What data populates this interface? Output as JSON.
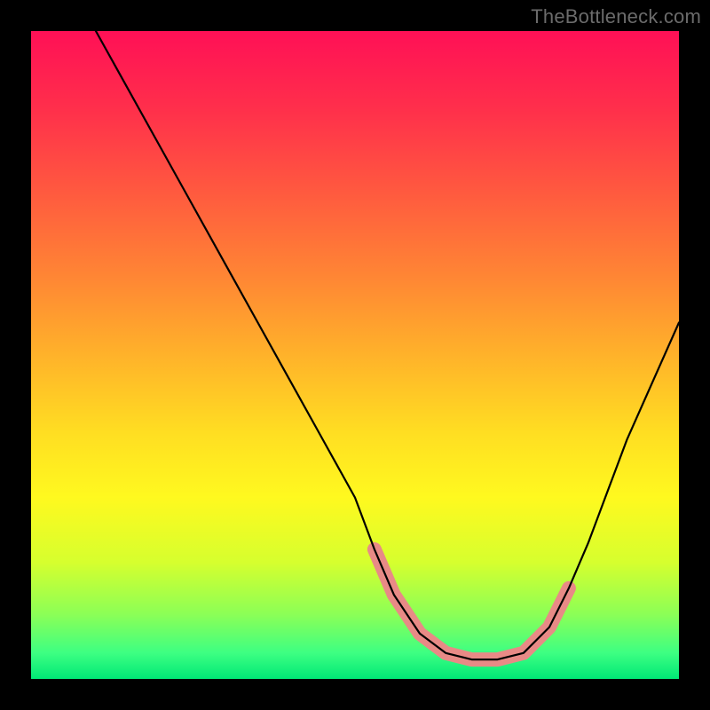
{
  "watermark": "TheBottleneck.com",
  "chart_data": {
    "type": "line",
    "title": "",
    "xlabel": "",
    "ylabel": "",
    "xlim": [
      0,
      100
    ],
    "ylim": [
      0,
      100
    ],
    "grid": false,
    "series": [
      {
        "name": "bottleneck-curve",
        "description": "V-shaped bottleneck curve descending from upper-left to a flat minimum then rising toward upper-right",
        "x": [
          10,
          15,
          20,
          25,
          30,
          35,
          40,
          45,
          50,
          53,
          56,
          60,
          64,
          68,
          72,
          76,
          80,
          83,
          86,
          89,
          92,
          96,
          100
        ],
        "y": [
          100,
          91,
          82,
          73,
          64,
          55,
          46,
          37,
          28,
          20,
          13,
          7,
          4,
          3,
          3,
          4,
          8,
          14,
          21,
          29,
          37,
          46,
          55
        ]
      },
      {
        "name": "highlight-band",
        "description": "Thick salmon band marking the flat minimum region of the curve",
        "x": [
          53,
          56,
          60,
          64,
          68,
          72,
          76,
          80,
          83
        ],
        "y": [
          20,
          13,
          7,
          4,
          3,
          3,
          4,
          8,
          14
        ],
        "color": "#e88a86",
        "stroke_width": 16
      }
    ],
    "background_gradient": {
      "direction": "top-to-bottom",
      "stops": [
        {
          "offset": 0.0,
          "color": "#ff1056"
        },
        {
          "offset": 0.12,
          "color": "#ff2f4b"
        },
        {
          "offset": 0.25,
          "color": "#ff5a3f"
        },
        {
          "offset": 0.38,
          "color": "#ff8634"
        },
        {
          "offset": 0.5,
          "color": "#ffb22a"
        },
        {
          "offset": 0.62,
          "color": "#ffde22"
        },
        {
          "offset": 0.72,
          "color": "#fff91f"
        },
        {
          "offset": 0.82,
          "color": "#d6ff2e"
        },
        {
          "offset": 0.9,
          "color": "#8cff56"
        },
        {
          "offset": 0.96,
          "color": "#3dff82"
        },
        {
          "offset": 1.0,
          "color": "#00e876"
        }
      ]
    }
  }
}
